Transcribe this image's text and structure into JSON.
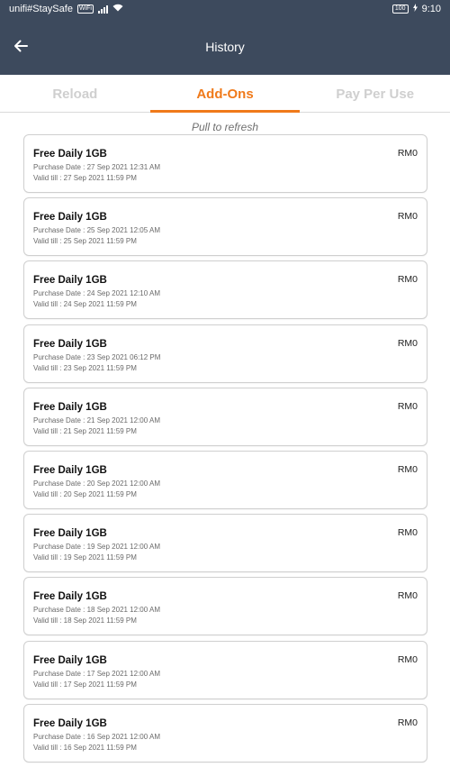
{
  "status_bar": {
    "network": "unifi#StaySafe",
    "network_badge": "WiFi",
    "battery": "100",
    "time": "9:10"
  },
  "app_bar": {
    "title": "History",
    "back_icon": "arrow-left-icon"
  },
  "tabs": [
    {
      "label": "Reload",
      "active": false
    },
    {
      "label": "Add-Ons",
      "active": true
    },
    {
      "label": "Pay Per Use",
      "active": false
    }
  ],
  "pull_to_refresh": "Pull to refresh",
  "colors": {
    "header": "#3d4a5d",
    "accent": "#f07a1a"
  },
  "items": [
    {
      "title": "Free Daily 1GB",
      "price": "RM0",
      "purchase": "Purchase Date : 27 Sep 2021 12:31 AM",
      "valid": "Valid till : 27 Sep 2021 11:59 PM"
    },
    {
      "title": "Free Daily 1GB",
      "price": "RM0",
      "purchase": "Purchase Date : 25 Sep 2021 12:05 AM",
      "valid": "Valid till : 25 Sep 2021 11:59 PM"
    },
    {
      "title": "Free Daily 1GB",
      "price": "RM0",
      "purchase": "Purchase Date : 24 Sep 2021 12:10 AM",
      "valid": "Valid till : 24 Sep 2021 11:59 PM"
    },
    {
      "title": "Free Daily 1GB",
      "price": "RM0",
      "purchase": "Purchase Date : 23 Sep 2021 06:12 PM",
      "valid": "Valid till : 23 Sep 2021 11:59 PM"
    },
    {
      "title": "Free Daily 1GB",
      "price": "RM0",
      "purchase": "Purchase Date : 21 Sep 2021 12:00 AM",
      "valid": "Valid till : 21 Sep 2021 11:59 PM"
    },
    {
      "title": "Free Daily 1GB",
      "price": "RM0",
      "purchase": "Purchase Date : 20 Sep 2021 12:00 AM",
      "valid": "Valid till : 20 Sep 2021 11:59 PM"
    },
    {
      "title": "Free Daily 1GB",
      "price": "RM0",
      "purchase": "Purchase Date : 19 Sep 2021 12:00 AM",
      "valid": "Valid till : 19 Sep 2021 11:59 PM"
    },
    {
      "title": "Free Daily 1GB",
      "price": "RM0",
      "purchase": "Purchase Date : 18 Sep 2021 12:00 AM",
      "valid": "Valid till : 18 Sep 2021 11:59 PM"
    },
    {
      "title": "Free Daily 1GB",
      "price": "RM0",
      "purchase": "Purchase Date : 17 Sep 2021 12:00 AM",
      "valid": "Valid till : 17 Sep 2021 11:59 PM"
    },
    {
      "title": "Free Daily 1GB",
      "price": "RM0",
      "purchase": "Purchase Date : 16 Sep 2021 12:00 AM",
      "valid": "Valid till : 16 Sep 2021 11:59 PM"
    }
  ]
}
